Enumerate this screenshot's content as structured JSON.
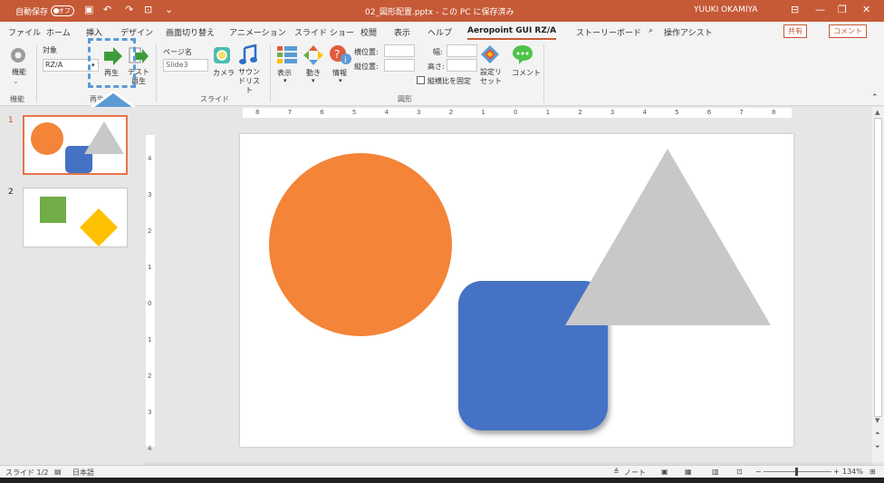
{
  "titlebar": {
    "autosave_label": "自動保存",
    "autosave_state": "オフ",
    "document_title": "02_図形配置.pptx - この PC に保存済み",
    "user_name": "YUUKI OKAMIYA"
  },
  "menubar": {
    "tabs": [
      "ファイル",
      "ホーム",
      "挿入",
      "デザイン",
      "画面切り替え",
      "アニメーション",
      "スライド ショー",
      "校閲",
      "表示",
      "ヘルプ",
      "Aeropoint GUI RZ/A",
      "ストーリーボード"
    ],
    "active_tab": "Aeropoint GUI RZ/A",
    "tell_me": "操作アシスト",
    "share_label": "共有",
    "comment_label": "コメント"
  },
  "ribbon": {
    "feature_label": "機能",
    "feature_group": "機能",
    "target_label": "対象",
    "target_value": "RZ/A",
    "play_label": "再生",
    "test_label": "テスト再生",
    "play_group": "再生",
    "page_name_label": "ページ名",
    "page_name_value": "Slide3",
    "camera_label": "カメラ",
    "sound_list_label": "サウンドリスト",
    "slide_group": "スライド",
    "display_label": "表示",
    "motion_label": "動き",
    "info_label": "情報",
    "pos_x_label": "横位置:",
    "pos_y_label": "縦位置:",
    "width_label": "幅:",
    "height_label": "高さ:",
    "lock_ratio_label": "縦横比を固定",
    "settings_reset_label": "設定リセット",
    "comment_label": "コメント",
    "shape_group": "図形"
  },
  "slides": [
    {
      "number": "1",
      "selected": true
    },
    {
      "number": "2",
      "selected": false
    }
  ],
  "ruler": {
    "h_ticks": [
      "8",
      "7",
      "6",
      "5",
      "4",
      "3",
      "2",
      "1",
      "0",
      "1",
      "2",
      "3",
      "4",
      "5",
      "6",
      "7",
      "8"
    ],
    "v_ticks": [
      "4",
      "3",
      "2",
      "1",
      "0",
      "1",
      "2",
      "3",
      "4"
    ]
  },
  "colors": {
    "accent": "#c65a37",
    "circle": "#f38438",
    "square": "#4472c4",
    "triangle": "#c8c8c8",
    "green_square": "#70ad47",
    "diamond": "#ffc000",
    "highlight_arrow": "#5b9bd5"
  },
  "statusbar": {
    "slide_info": "スライド 1/2",
    "language": "日本語",
    "notes_label": "ノート",
    "zoom": "134%"
  }
}
